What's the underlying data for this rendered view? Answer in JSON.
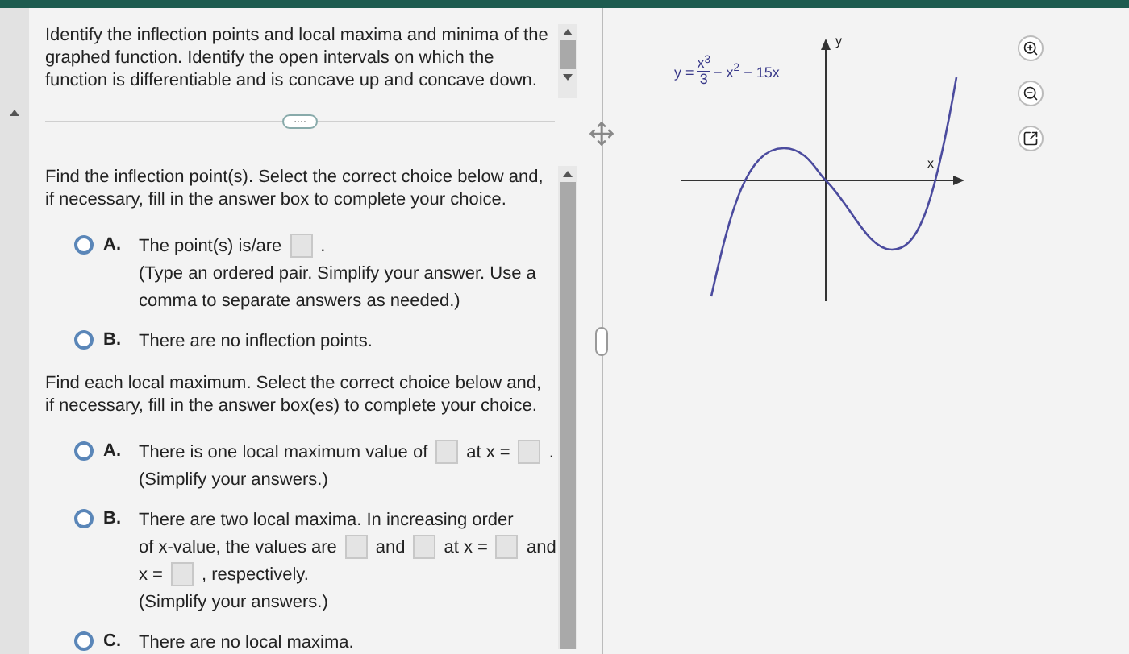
{
  "intro": "Identify the inflection points and local maxima and minima of the graphed function. Identify the open intervals on which the function is differentiable and is concave up and concave down.",
  "expand_button": "....",
  "parts": [
    {
      "prompt": "Find the inflection point(s). Select the correct choice below and, if necessary, fill in the answer box to complete your choice.",
      "choices": [
        {
          "letter": "A.",
          "selected": false,
          "lines": [
            [
              {
                "kind": "text",
                "text": "The point(s) is/are"
              },
              {
                "kind": "box"
              },
              {
                "kind": "text",
                "text": "."
              }
            ],
            [
              {
                "kind": "text",
                "text": "(Type an ordered pair. Simplify your answer. Use a"
              }
            ],
            [
              {
                "kind": "text",
                "text": "comma to separate answers as needed.)"
              }
            ]
          ]
        },
        {
          "letter": "B.",
          "selected": false,
          "lines": [
            [
              {
                "kind": "text",
                "text": "There are no inflection points."
              }
            ]
          ]
        }
      ]
    },
    {
      "prompt": "Find each local maximum. Select the correct choice below and, if necessary, fill in the answer box(es) to complete your choice.",
      "choices": [
        {
          "letter": "A.",
          "selected": false,
          "lines": [
            [
              {
                "kind": "text",
                "text": "There is one local maximum value of"
              },
              {
                "kind": "box"
              },
              {
                "kind": "text",
                "text": "at x ="
              },
              {
                "kind": "box"
              },
              {
                "kind": "text",
                "text": "."
              }
            ],
            [
              {
                "kind": "text",
                "text": "(Simplify your answers.)"
              }
            ]
          ]
        },
        {
          "letter": "B.",
          "selected": false,
          "lines": [
            [
              {
                "kind": "text",
                "text": "There are two local maxima. In increasing order"
              }
            ],
            [
              {
                "kind": "text",
                "text": "of x-value, the values are"
              },
              {
                "kind": "box"
              },
              {
                "kind": "text",
                "text": "and"
              },
              {
                "kind": "box"
              },
              {
                "kind": "text",
                "text": "at x ="
              },
              {
                "kind": "box"
              },
              {
                "kind": "text",
                "text": "and"
              }
            ],
            [
              {
                "kind": "text",
                "text": "x ="
              },
              {
                "kind": "box"
              },
              {
                "kind": "text",
                "text": ", respectively."
              }
            ],
            [
              {
                "kind": "text",
                "text": "(Simplify your answers.)"
              }
            ]
          ]
        },
        {
          "letter": "C.",
          "selected": false,
          "lines": [
            [
              {
                "kind": "text",
                "text": "There are no local maxima."
              }
            ]
          ]
        }
      ]
    }
  ],
  "graph": {
    "equation": {
      "lhs": "y =",
      "numerator": "x$^{3}$",
      "denominator": "3",
      "rest": "− x$^{2}$ − 15x"
    },
    "x_label": "x",
    "y_label": "y"
  }
}
